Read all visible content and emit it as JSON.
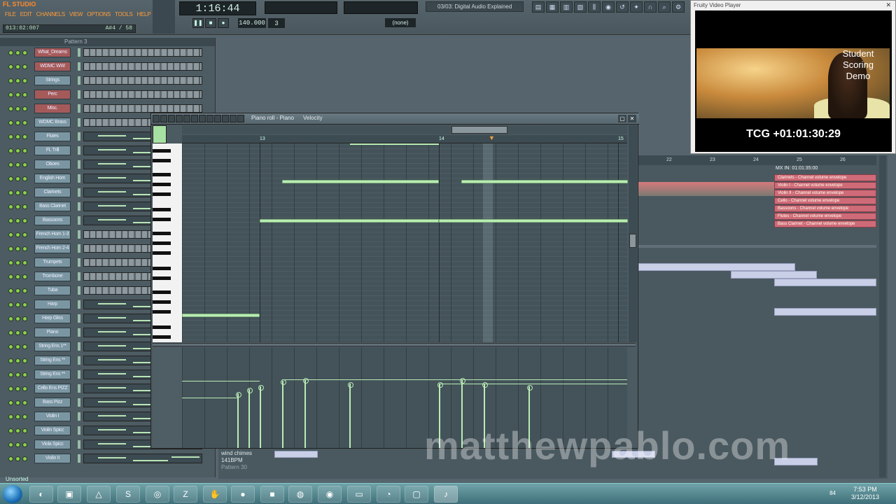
{
  "app": {
    "logo": "FL STUDIO"
  },
  "menu": [
    "FILE",
    "EDIT",
    "CHANNELS",
    "VIEW",
    "OPTIONS",
    "TOOLS",
    "HELP"
  ],
  "songpos": {
    "left": "013:02:007",
    "right": "A#4 / 58"
  },
  "time_display": "1:16:44",
  "tempo": "140.000",
  "pattern_num": "3",
  "snap": "(none)",
  "hint_text": "03/03: Digital Audio Explained",
  "rack": {
    "pattern_label": "Pattern 3",
    "channels": [
      "What_Dreams",
      "WDMC WW",
      "Strings",
      "Perc",
      "Misc.",
      "WDMC Brass",
      "Flutes",
      "FL Trill",
      "Oboes",
      "English Horn",
      "Clarinets",
      "Bass Clarinet",
      "Bassoons",
      "French Horn 1-3",
      "French Horn 2-4",
      "Trumpets",
      "Trombone",
      "Tuba",
      "Harp",
      "Harp Gliss",
      "Piano",
      "String Ens 1**",
      "String Ens **",
      "String Ens **",
      "Cello Ens PIZZ",
      "Bass Pizz",
      "Violin I",
      "Violin Spicc",
      "Viola Spicc",
      "Violin II"
    ],
    "unsorted_label": "Unsorted"
  },
  "pianoroll": {
    "title": "Piano roll - Piano",
    "target": "Velocity",
    "ruler": [
      "13",
      "14",
      "15"
    ]
  },
  "playlist": {
    "ruler": [
      "22",
      "23",
      "24",
      "25",
      "26"
    ],
    "marker": "MX IN: 01:01:35:00",
    "envelopes": [
      "Clarinets - Channel volume envelope",
      "Violin I - Channel volume envelope",
      "Violin II - Channel volume envelope",
      "Cello - Channel volume envelope",
      "Bassoons - Channel volume envelope",
      "Flutes - Channel volume envelope",
      "Bass Clarinet - Channel volume envelope"
    ],
    "bottom_track": {
      "name": "wind chimes",
      "bpm": "141BPM",
      "pattern": "Pattern 30",
      "extra": "Playlist 32"
    }
  },
  "video": {
    "title": "Fruity Video Player",
    "caption": "Student Scoring Demo",
    "timecode": "TCG +01:01:30:29"
  },
  "watermark": "matthewpablo.com",
  "taskbar": {
    "time": "7:53 PM",
    "date": "3/12/2013",
    "tray": "84"
  }
}
